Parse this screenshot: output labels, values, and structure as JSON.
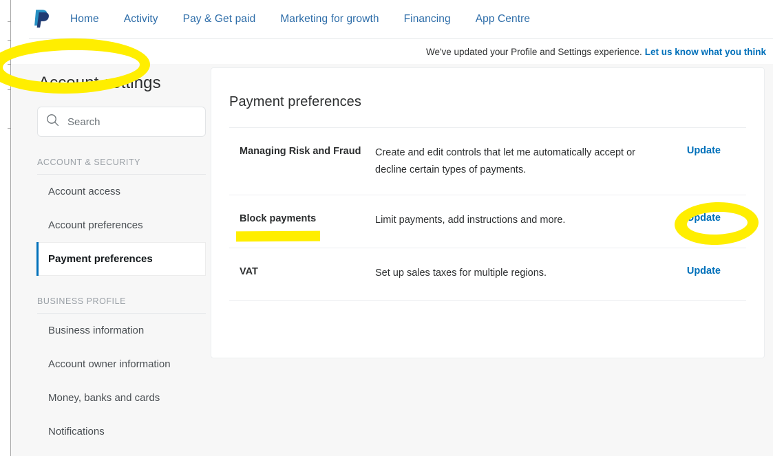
{
  "brand": {
    "logo_name": "paypal-logo",
    "logo_color_light": "#2790c3",
    "logo_color_dark": "#1f3b73",
    "accent_link": "#0070ba",
    "marker_color": "#ffee00"
  },
  "topnav": {
    "items": [
      {
        "label": "Home",
        "name": "nav-home"
      },
      {
        "label": "Activity",
        "name": "nav-activity"
      },
      {
        "label": "Pay & Get paid",
        "name": "nav-pay-get-paid"
      },
      {
        "label": "Marketing for growth",
        "name": "nav-marketing-for-growth"
      },
      {
        "label": "Financing",
        "name": "nav-financing"
      },
      {
        "label": "App Centre",
        "name": "nav-app-centre"
      }
    ]
  },
  "notice": {
    "text": "We've updated your Profile and Settings experience.",
    "link_label": "Let us know what you think"
  },
  "sidebar": {
    "title": "Account settings",
    "search": {
      "placeholder": "Search",
      "value": "",
      "icon": "search-icon"
    },
    "sections": [
      {
        "label": "ACCOUNT & SECURITY",
        "items": [
          {
            "label": "Account access",
            "active": false
          },
          {
            "label": "Account preferences",
            "active": false
          },
          {
            "label": "Payment preferences",
            "active": true
          }
        ]
      },
      {
        "label": "BUSINESS PROFILE",
        "items": [
          {
            "label": "Business information",
            "active": false
          },
          {
            "label": "Account owner information",
            "active": false
          },
          {
            "label": "Money, banks and cards",
            "active": false
          },
          {
            "label": "Notifications",
            "active": false
          }
        ]
      }
    ]
  },
  "main": {
    "title": "Payment preferences",
    "rows": [
      {
        "name": "Managing Risk and Fraud",
        "description": "Create and edit controls that let me automatically accept or decline certain types of payments.",
        "action_label": "Update"
      },
      {
        "name": "Block payments",
        "description": "Limit payments, add instructions and more.",
        "action_label": "Update"
      },
      {
        "name": "VAT",
        "description": "Set up sales taxes for multiple regions.",
        "action_label": "Update"
      }
    ]
  },
  "annotations": [
    {
      "name": "highlight-account-settings",
      "shape": "ellipse",
      "target": "Account settings"
    },
    {
      "name": "highlight-block-payments",
      "shape": "underline",
      "target": "Block payments"
    },
    {
      "name": "highlight-update-block-payments",
      "shape": "ellipse",
      "target": "Update"
    }
  ]
}
